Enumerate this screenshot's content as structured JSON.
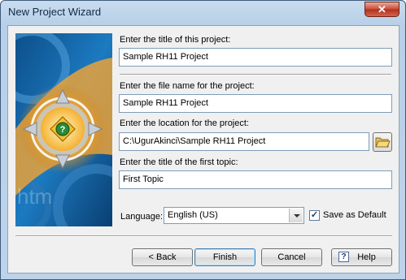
{
  "window": {
    "title": "New Project Wizard",
    "close_glyph": "✕"
  },
  "form": {
    "project_title_label": "Enter the title of this project:",
    "project_title_value": "Sample RH11 Project",
    "file_name_label": "Enter the file name for the project:",
    "file_name_value": "Sample RH11 Project",
    "location_label": "Enter the location for the project:",
    "location_value": "C:\\UgurAkinci\\Sample RH11 Project",
    "first_topic_label": "Enter the title of the first topic:",
    "first_topic_value": "First Topic",
    "language_label": "Language:",
    "language_value": "English (US)",
    "save_default_label": "Save as Default",
    "save_default_checked": true,
    "check_glyph": "✓"
  },
  "buttons": {
    "back": "< Back",
    "finish": "Finish",
    "cancel": "Cancel",
    "help": "Help",
    "help_glyph": "?"
  },
  "art": {
    "watermark": "htm",
    "question_glyph": "?"
  },
  "icons": {
    "browse": "folder-open-icon",
    "help": "help-icon",
    "close": "close-icon",
    "wizard_art": "wizard-banner-art"
  }
}
